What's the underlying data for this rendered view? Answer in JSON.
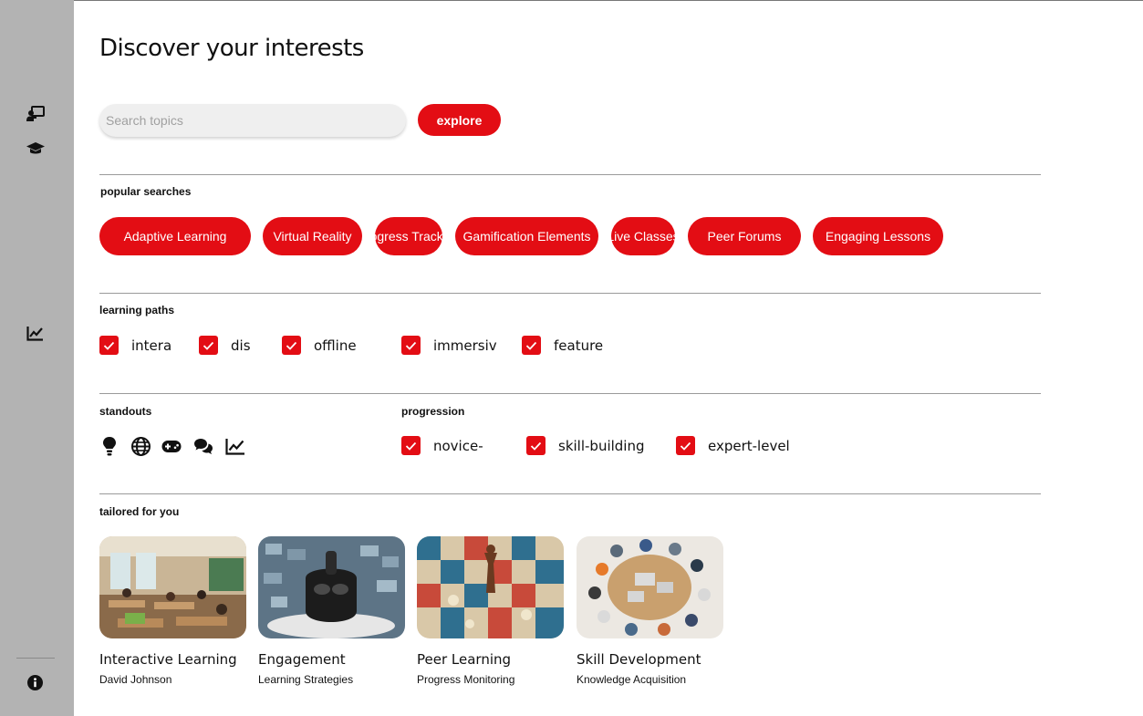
{
  "page": {
    "title": "Discover your interests",
    "accent": "#e30d14",
    "sidebar_bg": "#b3b3b3"
  },
  "sidebar": {
    "icons": [
      "chalkboard-teacher-icon",
      "graduation-cap-icon",
      "chart-line-icon",
      "info-circle-icon"
    ]
  },
  "search": {
    "placeholder": "Search topics",
    "value": "",
    "button_label": "explore"
  },
  "popular": {
    "label": "popular searches",
    "chips": [
      "Adaptive Learning",
      "Virtual Reality",
      "Progress Tracking",
      "Gamification Elements",
      "Live Classes",
      "Peer Forums",
      "Engaging Lessons"
    ]
  },
  "paths": {
    "label": "learning paths",
    "options": [
      {
        "label": "intera",
        "checked": true
      },
      {
        "label": "dis",
        "checked": true
      },
      {
        "label": "offline",
        "checked": true
      },
      {
        "label": "immersiv",
        "checked": true
      },
      {
        "label": "feature",
        "checked": true
      }
    ]
  },
  "standouts": {
    "label": "standouts",
    "icons": [
      "lightbulb-icon",
      "globe-icon",
      "gamepad-icon",
      "comments-icon",
      "chart-line-icon"
    ]
  },
  "progression": {
    "label": "progression",
    "options": [
      {
        "label": "novice-",
        "checked": true
      },
      {
        "label": "skill-building",
        "checked": true
      },
      {
        "label": "expert-level",
        "checked": true
      }
    ]
  },
  "tailored": {
    "label": "tailored for you",
    "cards": [
      {
        "title": "Interactive Learning",
        "subtitle": "David Johnson"
      },
      {
        "title": "Engagement",
        "subtitle": "Learning Strategies"
      },
      {
        "title": "Peer Learning",
        "subtitle": "Progress Monitoring"
      },
      {
        "title": "Skill Development",
        "subtitle": "Knowledge Acquisition"
      }
    ]
  }
}
